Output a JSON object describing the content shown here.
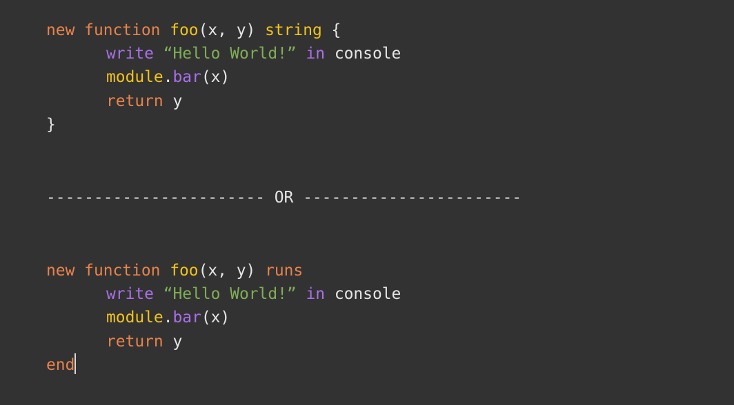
{
  "colors": {
    "background": "#333233",
    "keyword": "#e8834a",
    "function_name": "#f0c419",
    "purple_keyword": "#a970e8",
    "string": "#7fae55",
    "plain": "#e6e6e6"
  },
  "block1": {
    "line1": [
      {
        "text": "new",
        "color": "#e8834a"
      },
      {
        "text": " ",
        "color": "#e6e6e6"
      },
      {
        "text": "function",
        "color": "#e8834a"
      },
      {
        "text": " ",
        "color": "#e6e6e6"
      },
      {
        "text": "foo",
        "color": "#f0c419"
      },
      {
        "text": "(x, y) ",
        "color": "#e6e6e6"
      },
      {
        "text": "string",
        "color": "#f0c419"
      },
      {
        "text": " {",
        "color": "#e6e6e6"
      }
    ],
    "line2": [
      {
        "text": "write",
        "color": "#a970e8"
      },
      {
        "text": " ",
        "color": "#e6e6e6"
      },
      {
        "text": "“Hello World!”",
        "color": "#7fae55"
      },
      {
        "text": " ",
        "color": "#e6e6e6"
      },
      {
        "text": "in",
        "color": "#a970e8"
      },
      {
        "text": " console",
        "color": "#e6e6e6"
      }
    ],
    "line3": [
      {
        "text": "module",
        "color": "#f0c419"
      },
      {
        "text": ".",
        "color": "#e6e6e6"
      },
      {
        "text": "bar",
        "color": "#a970e8"
      },
      {
        "text": "(x)",
        "color": "#e6e6e6"
      }
    ],
    "line4": [
      {
        "text": "return",
        "color": "#e8834a"
      },
      {
        "text": " y",
        "color": "#e6e6e6"
      }
    ],
    "line5": [
      {
        "text": "}",
        "color": "#e6e6e6"
      }
    ]
  },
  "separator": "----------------------- OR -----------------------",
  "block2": {
    "line1": [
      {
        "text": "new",
        "color": "#e8834a"
      },
      {
        "text": " ",
        "color": "#e6e6e6"
      },
      {
        "text": "function",
        "color": "#e8834a"
      },
      {
        "text": " ",
        "color": "#e6e6e6"
      },
      {
        "text": "foo",
        "color": "#f0c419"
      },
      {
        "text": "(x, y) ",
        "color": "#e6e6e6"
      },
      {
        "text": "runs",
        "color": "#e8834a"
      }
    ],
    "line2": [
      {
        "text": "write",
        "color": "#a970e8"
      },
      {
        "text": " ",
        "color": "#e6e6e6"
      },
      {
        "text": "“Hello World!”",
        "color": "#7fae55"
      },
      {
        "text": " ",
        "color": "#e6e6e6"
      },
      {
        "text": "in",
        "color": "#a970e8"
      },
      {
        "text": " console",
        "color": "#e6e6e6"
      }
    ],
    "line3": [
      {
        "text": "module",
        "color": "#f0c419"
      },
      {
        "text": ".",
        "color": "#e6e6e6"
      },
      {
        "text": "bar",
        "color": "#a970e8"
      },
      {
        "text": "(x)",
        "color": "#e6e6e6"
      }
    ],
    "line4": [
      {
        "text": "return",
        "color": "#e8834a"
      },
      {
        "text": " y",
        "color": "#e6e6e6"
      }
    ],
    "line5": [
      {
        "text": "end",
        "color": "#e8834a"
      }
    ]
  }
}
